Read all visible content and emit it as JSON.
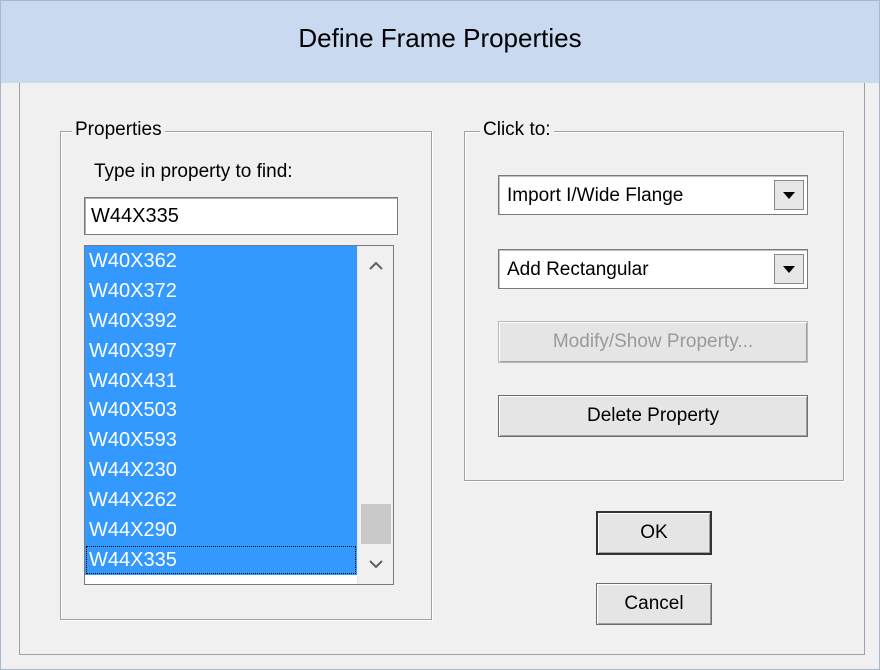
{
  "window": {
    "title": "Define Frame Properties"
  },
  "properties": {
    "group_label": "Properties",
    "find_label": "Type in property to find:",
    "find_value": "W44X335",
    "items": [
      "W40X362",
      "W40X372",
      "W40X392",
      "W40X397",
      "W40X431",
      "W40X503",
      "W40X593",
      "W44X230",
      "W44X262",
      "W44X290",
      "W44X335"
    ]
  },
  "click_to": {
    "group_label": "Click to:",
    "import_select": "Import I/Wide Flange",
    "add_select": "Add Rectangular",
    "modify_button": "Modify/Show Property...",
    "delete_button": "Delete Property"
  },
  "buttons": {
    "ok": "OK",
    "cancel": "Cancel"
  },
  "icons": {
    "scroll_up": "chevron-up-icon",
    "scroll_down": "chevron-down-icon",
    "dropdown": "triangle-down-icon"
  },
  "colors": {
    "titlebar": "#c9daf0",
    "selection": "#3399ff"
  }
}
